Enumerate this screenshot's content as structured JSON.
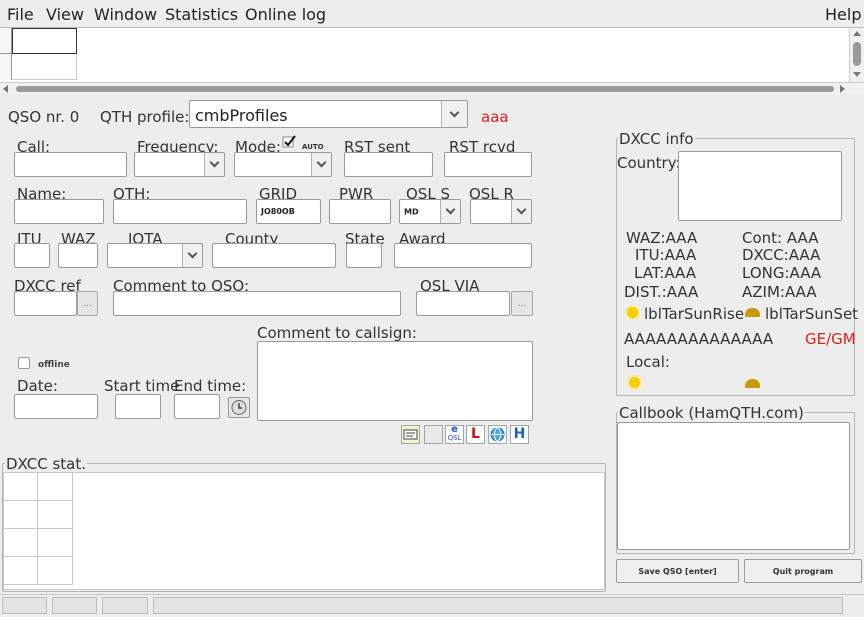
{
  "menu": {
    "file": "File",
    "view": "View",
    "window": "Window",
    "statistics": "Statistics",
    "online_log": "Online log",
    "help": "Help"
  },
  "qso": {
    "qso_nr": "QSO nr. 0",
    "qth_profile_label": "QTH profile:",
    "qth_profile_value": "cmbProfiles",
    "profile_tag": "aaa"
  },
  "fields": {
    "call": "Call:",
    "frequency": "Frequency:",
    "mode": "Mode:",
    "auto": "AUTO",
    "rst_sent": "RST sent",
    "rst_rcvd": "RST rcvd",
    "name": "Name:",
    "qth": "QTH:",
    "grid": "GRID",
    "grid_value": "JO80OB",
    "pwr": "PWR",
    "qsl_s": "QSL S",
    "qsl_s_value": "MD",
    "qsl_r": "QSL R",
    "itu": "ITU",
    "waz": "WAZ",
    "iota": "IOTA",
    "county": "County",
    "state": "State",
    "award": "Award",
    "dxcc_ref": "DXCC ref",
    "dxcc_btn": "...",
    "comment_qso": "Comment to QSO:",
    "qsl_via": "QSL VIA",
    "qsl_btn": "...",
    "comment_call": "Comment to callsign:",
    "offline": "offline",
    "date": "Date:",
    "start_time": "Start time",
    "end_time": "End time:"
  },
  "dxcc_stat": {
    "title": "DXCC stat."
  },
  "dxcc_info": {
    "title": "DXCC info",
    "country": "Country:",
    "waz": "WAZ:AAA",
    "cont": "Cont: AAA",
    "itu": "ITU:AAA",
    "dxcc": "DXCC:AAA",
    "lat": "LAT:AAA",
    "long": "LONG:AAA",
    "dist": "DIST.:AAA",
    "azim": "AZIM:AAA",
    "sunrise": "lblTarSunRise",
    "sunset": "lblTarSunSet",
    "long_label": "AAAAAAAAAAAAAA",
    "gegm": "GE/GM",
    "local": "Local:"
  },
  "callbook": {
    "title": "Callbook (HamQTH.com)"
  },
  "buttons": {
    "save": "Save QSO [enter]",
    "quit": "Quit program"
  },
  "toolbar_icons": {
    "qsl_letter": "e",
    "qsl_text": "QSL",
    "l_badge": "L",
    "h_badge": "H"
  },
  "colors": {
    "accent_red": "#e02020",
    "background": "#ededed"
  }
}
